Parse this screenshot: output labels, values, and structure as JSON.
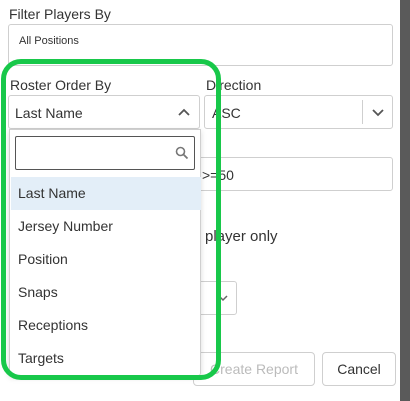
{
  "filter": {
    "label": "Filter Players By",
    "value": "All Positions"
  },
  "roster_order": {
    "label": "Roster Order By",
    "selected": "Last Name",
    "search_value": "",
    "options": [
      "Last Name",
      "Jersey Number",
      "Position",
      "Snaps",
      "Receptions",
      "Targets"
    ],
    "highlighted_option": "Last Name"
  },
  "direction": {
    "label": "Direction",
    "value": "ASC"
  },
  "threshold": {
    "value": ">=50"
  },
  "player_only": {
    "label": "player only"
  },
  "actions": {
    "create_label": "Create Report",
    "cancel_label": "Cancel"
  },
  "colors": {
    "highlight": "#18c84a",
    "selected_option_bg": "#e3eef8"
  }
}
